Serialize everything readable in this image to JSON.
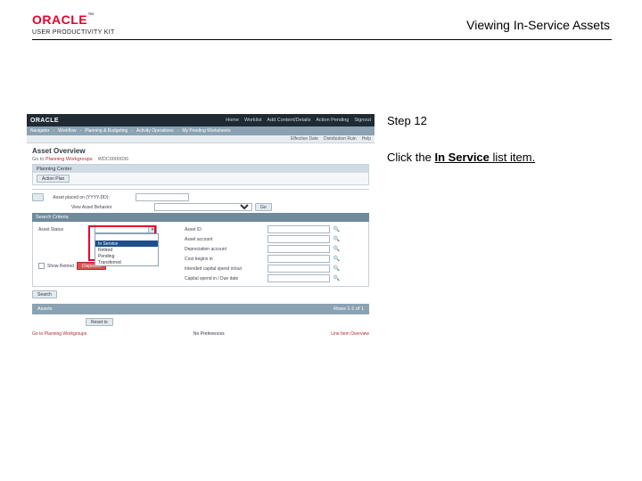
{
  "doc": {
    "title": "Viewing In-Service Assets",
    "logo_word": "ORACLE",
    "logo_sub": "USER PRODUCTIVITY KIT"
  },
  "instruction": {
    "step_label": "Step 12",
    "line_pre": "Click the ",
    "line_bold": "In Service",
    "line_post": " list item."
  },
  "app": {
    "brand": "ORACLE",
    "top_menus": [
      "Home",
      "Worklist",
      "Add Content/Details",
      "Action Pending",
      "Signout"
    ],
    "crumbs": [
      "Navigator",
      "Workflow",
      "Planning & Budgeting",
      "Activity Operations",
      "My Pending Worksheets"
    ],
    "tab_links": [
      "Effective Date",
      "Distribution Ruin",
      "Help"
    ],
    "page_title": "Asset Overview",
    "crumb2_pre": "Go to ",
    "crumb2_link": "Planning Workgroups",
    "crumb2_id": "WDC0000036",
    "pcenter_hdr": "Planning Center",
    "action_btn": "Action Plan",
    "asset_date_lbl": "Asset placed on (YYYY-DD):",
    "asset_date_val": "",
    "view_lbl": "View Asset Behavior",
    "view_val": "",
    "go_btn": "Go",
    "search_hdr": "Search Criteria",
    "left": {
      "status_lbl": "Asset Status",
      "status_opts": [
        "",
        "In Service",
        "Retired",
        "Pending",
        "Transferred"
      ],
      "status_sel": "",
      "show_retired_lbl": "Show Retired",
      "disposed_btn": "Disposed"
    },
    "right": {
      "r1": "Asset ID",
      "r2": "Asset account",
      "r3": "Depreciation account",
      "r4": "Cost begins in",
      "r5": "Intended capital spend in/out",
      "r6": "Capital spend in / Due date"
    },
    "search_btn": "Search",
    "greybar_left": "Assets",
    "greybar_right": "Rows 1-1 of 1",
    "reset_btn": "Reset to",
    "footer_left": "Go to Planning Workgroups",
    "footer_mid_k": "No Preferences",
    "footer_right": "Line Item Overview"
  }
}
